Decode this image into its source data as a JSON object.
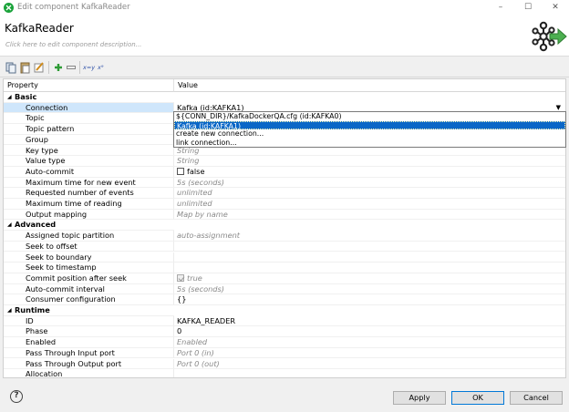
{
  "window": {
    "title": "Edit component KafkaReader",
    "controls": {
      "minimize": "–",
      "maximize": "☐",
      "close": "✕"
    }
  },
  "header": {
    "component_name": "KafkaReader",
    "description_placeholder": "Click here to edit component description..."
  },
  "toolbar": {
    "buttons": [
      "copy-icon",
      "paste-icon",
      "edit-icon",
      "add-icon",
      "remove-icon",
      "swap-icon",
      "bind-icon"
    ],
    "swap_label": "x=y",
    "bind_label": "x⁹"
  },
  "grid": {
    "headers": {
      "property": "Property",
      "value": "Value"
    },
    "categories": {
      "basic": "Basic",
      "advanced": "Advanced",
      "runtime": "Runtime"
    },
    "basic": [
      {
        "label": "Connection",
        "value": "Kafka (id:KAFKA1)"
      },
      {
        "label": "Topic",
        "value": ""
      },
      {
        "label": "Topic pattern",
        "value": ""
      },
      {
        "label": "Group",
        "value": ""
      },
      {
        "label": "Key type",
        "value": "String"
      },
      {
        "label": "Value type",
        "value": "String"
      },
      {
        "label": "Auto-commit",
        "value": "false"
      },
      {
        "label": "Maximum time for new event",
        "value": "5s (seconds)"
      },
      {
        "label": "Requested number of events",
        "value": "unlimited"
      },
      {
        "label": "Maximum time of reading",
        "value": "unlimited"
      },
      {
        "label": "Output mapping",
        "value": "Map by name"
      }
    ],
    "advanced": [
      {
        "label": "Assigned topic partition",
        "value": "auto-assignment"
      },
      {
        "label": "Seek to offset",
        "value": ""
      },
      {
        "label": "Seek to boundary",
        "value": ""
      },
      {
        "label": "Seek to timestamp",
        "value": ""
      },
      {
        "label": "Commit position after seek",
        "value": "true"
      },
      {
        "label": "Auto-commit interval",
        "value": "5s (seconds)"
      },
      {
        "label": "Consumer configuration",
        "value": "{}"
      }
    ],
    "runtime": [
      {
        "label": "ID",
        "value": "KAFKA_READER"
      },
      {
        "label": "Phase",
        "value": "0"
      },
      {
        "label": "Enabled",
        "value": "Enabled"
      },
      {
        "label": "Pass Through Input port",
        "value": "Port 0 (in)"
      },
      {
        "label": "Pass Through Output port",
        "value": "Port 0 (out)"
      },
      {
        "label": "Allocation",
        "value": ""
      }
    ]
  },
  "dropdown": {
    "options": [
      "${CONN_DIR}/KafkaDockerQA.cfg (id:KAFKA0)",
      "Kafka (id:KAFKA1)",
      "create new connection...",
      "link connection..."
    ],
    "selected_index": 1
  },
  "footer": {
    "help": "?",
    "apply": "Apply",
    "ok": "OK",
    "cancel": "Cancel"
  }
}
